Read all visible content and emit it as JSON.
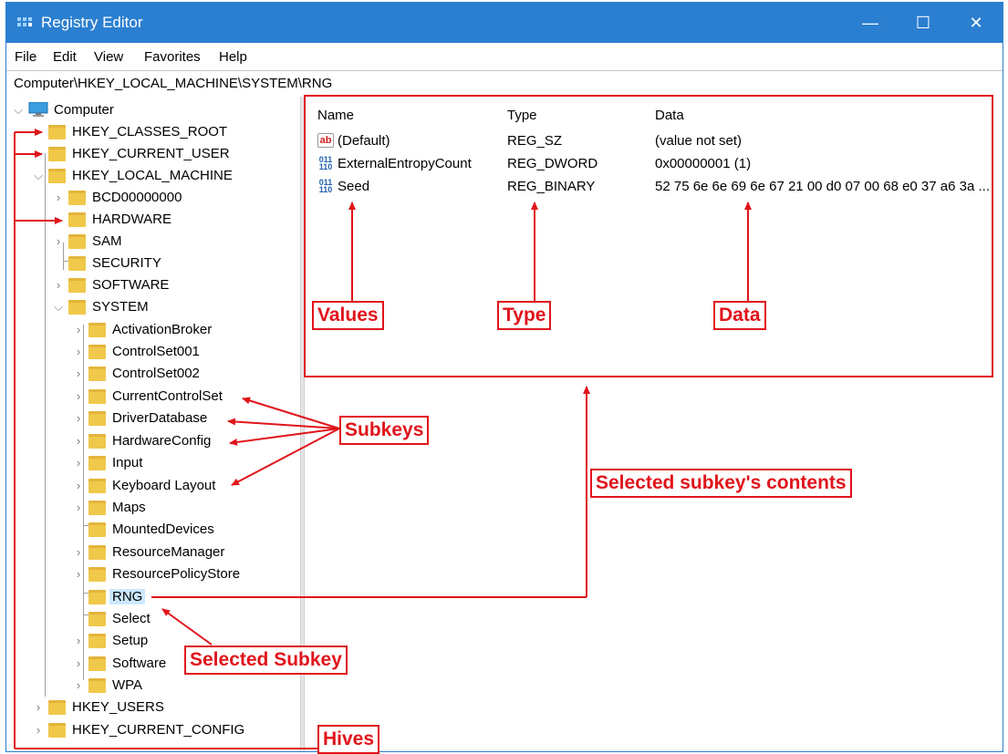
{
  "window": {
    "title": "Registry Editor",
    "controls": {
      "minimize": "—",
      "maximize": "☐",
      "close": "✕"
    }
  },
  "menubar": [
    "File",
    "Edit",
    "View",
    "Favorites",
    "Help"
  ],
  "address": "Computer\\HKEY_LOCAL_MACHINE\\SYSTEM\\RNG",
  "tree": {
    "root": "Computer",
    "hives": {
      "classes_root": "HKEY_CLASSES_ROOT",
      "current_user": "HKEY_CURRENT_USER",
      "local_machine": "HKEY_LOCAL_MACHINE",
      "users": "HKEY_USERS",
      "current_config": "HKEY_CURRENT_CONFIG"
    },
    "hklm_children": [
      "BCD00000000",
      "HARDWARE",
      "SAM",
      "SECURITY",
      "SOFTWARE",
      "SYSTEM"
    ],
    "system_children": [
      "ActivationBroker",
      "ControlSet001",
      "ControlSet002",
      "CurrentControlSet",
      "DriverDatabase",
      "HardwareConfig",
      "Input",
      "Keyboard Layout",
      "Maps",
      "MountedDevices",
      "ResourceManager",
      "ResourcePolicyStore",
      "RNG",
      "Select",
      "Setup",
      "Software",
      "WPA"
    ],
    "selected": "RNG"
  },
  "values_pane": {
    "headers": {
      "name": "Name",
      "type": "Type",
      "data": "Data"
    },
    "rows": [
      {
        "icon": "string-value-icon",
        "icon_text": "ab",
        "name": "(Default)",
        "type": "REG_SZ",
        "data": "(value not set)"
      },
      {
        "icon": "binary-value-icon",
        "icon_text": "011 110",
        "name": "ExternalEntropyCount",
        "type": "REG_DWORD",
        "data": "0x00000001 (1)"
      },
      {
        "icon": "binary-value-icon",
        "icon_text": "011 110",
        "name": "Seed",
        "type": "REG_BINARY",
        "data": "52 75 6e 6e 69 6e 67 21 00 d0 07 00 68 e0 37 a6 3a ..."
      }
    ]
  },
  "annotations": {
    "values": "Values",
    "type": "Type",
    "data": "Data",
    "subkeys": "Subkeys",
    "contents": "Selected subkey's contents",
    "selected_subkey": "Selected Subkey",
    "hives": "Hives"
  },
  "colors": {
    "titlebar": "#2b7fd0",
    "annotation": "#e0141b",
    "folder": "#f0c84a",
    "selection": "#cce8ff"
  }
}
